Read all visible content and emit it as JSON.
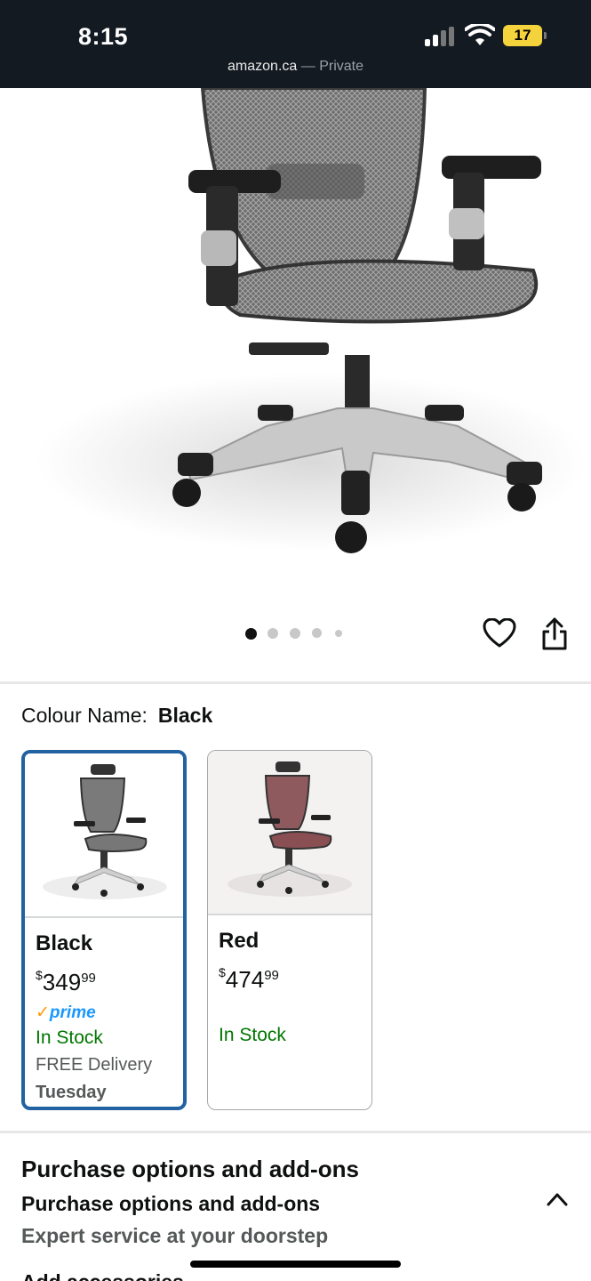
{
  "status": {
    "time": "8:15",
    "battery": "17"
  },
  "browser": {
    "domain": "amazon.ca",
    "separator": "—",
    "mode": "Private"
  },
  "carousel": {
    "dots": 5,
    "active_index": 0
  },
  "icons": {
    "heart": "heart-icon",
    "share": "share-icon",
    "chevron": "chevron-up-icon"
  },
  "colour": {
    "label": "Colour Name:",
    "selected": "Black"
  },
  "swatches": [
    {
      "name": "Black",
      "currency": "$",
      "dollars": "349",
      "cents": "99",
      "prime": "prime",
      "stock": "In Stock",
      "delivery": "FREE Delivery",
      "delivery_day": "Tuesday",
      "selected": true
    },
    {
      "name": "Red",
      "currency": "$",
      "dollars": "474",
      "cents": "99",
      "stock": "In Stock",
      "selected": false
    }
  ],
  "purchase": {
    "title": "Purchase options and add-ons",
    "subtitle": "Purchase options and add-ons",
    "subtitle2": "Expert service at your doorstep",
    "next_cut": "Add accessories"
  },
  "colors": {
    "accent_blue": "#2162a1",
    "stock_green": "#007600",
    "prime_blue": "#1a98ff",
    "prime_orange": "#ff9900",
    "status_bg": "#141a22"
  }
}
